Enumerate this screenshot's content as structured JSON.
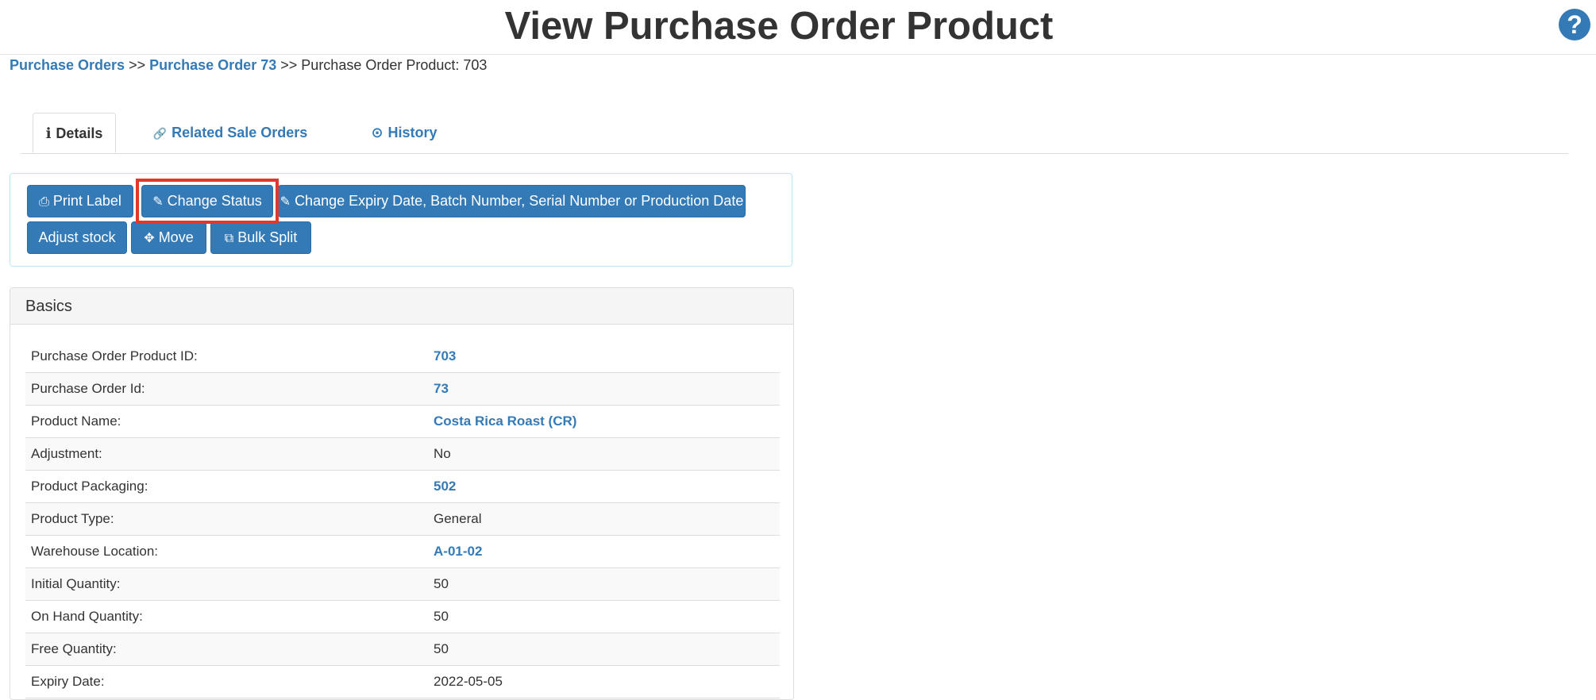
{
  "header": {
    "title": "View Purchase Order Product",
    "help_label": "?"
  },
  "breadcrumb": {
    "items": [
      {
        "label": "Purchase Orders"
      },
      {
        "label": "Purchase Order 73"
      }
    ],
    "separator": ">>",
    "current": "Purchase Order Product: 703"
  },
  "tabs": [
    {
      "icon": "info-icon",
      "glyph": "ℹ",
      "label": "Details",
      "active": true
    },
    {
      "icon": "link-icon",
      "glyph": "🔗",
      "label": "Related Sale Orders",
      "active": false
    },
    {
      "icon": "clock-icon",
      "glyph": "⊙",
      "label": "History",
      "active": false
    }
  ],
  "actions": {
    "print_label": "Print Label",
    "change_status": "Change Status",
    "change_expiry": "Change Expiry Date, Batch Number, Serial Number or Production Date",
    "adjust_stock": "Adjust stock",
    "move": "Move",
    "bulk_split": "Bulk Split"
  },
  "basics": {
    "title": "Basics",
    "rows": [
      {
        "label": "Purchase Order Product ID:",
        "value": "703",
        "link": true
      },
      {
        "label": "Purchase Order Id:",
        "value": "73",
        "link": true
      },
      {
        "label": "Product Name:",
        "value": "Costa Rica Roast (CR)",
        "link": true
      },
      {
        "label": "Adjustment:",
        "value": "No",
        "link": false
      },
      {
        "label": "Product Packaging:",
        "value": "502",
        "link": true
      },
      {
        "label": "Product Type:",
        "value": "General",
        "link": false
      },
      {
        "label": "Warehouse Location:",
        "value": "A-01-02",
        "link": true
      },
      {
        "label": "Initial Quantity:",
        "value": "50",
        "link": false
      },
      {
        "label": "On Hand Quantity:",
        "value": "50",
        "link": false
      },
      {
        "label": "Free Quantity:",
        "value": "50",
        "link": false
      },
      {
        "label": "Expiry Date:",
        "value": "2022-05-05",
        "link": false
      },
      {
        "label": "",
        "value": "",
        "link": false
      }
    ]
  },
  "colors": {
    "primary": "#337ab7",
    "highlight": "#e0392b",
    "text": "#333333"
  }
}
